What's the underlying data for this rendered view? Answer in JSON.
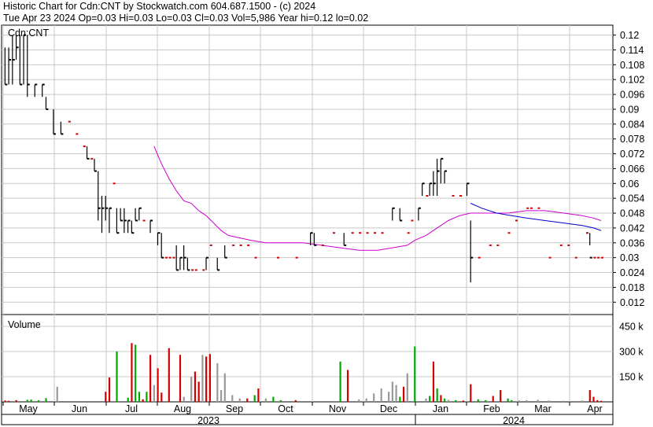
{
  "header": {
    "title": "Historic Chart for Cdn:CNT by Stockwatch.com 604.687.1500 - (c) 2024",
    "quote": "Tue Apr 23 2024  Op=0.03  Hi=0.03  Lo=0.03  Cl=0.03  Vol=5,986  Year hi=0.12  lo=0.02"
  },
  "chart_data": {
    "type": "bar",
    "symbol_label": "Cdn:CNT",
    "volume_label": "Volume",
    "price_axis": {
      "ticks": [
        0.12,
        0.114,
        0.108,
        0.102,
        0.096,
        0.09,
        0.084,
        0.078,
        0.072,
        0.066,
        0.06,
        0.054,
        0.048,
        0.042,
        0.036,
        0.03,
        0.024,
        0.018,
        0.012
      ],
      "range": [
        0.007,
        0.124
      ]
    },
    "volume_axis": {
      "ticks": [
        "450 k",
        "300 k",
        "150 k"
      ],
      "tick_values": [
        450000,
        300000,
        150000
      ],
      "range": [
        0,
        520000
      ]
    },
    "months": [
      "May",
      "Jun",
      "Jul",
      "Aug",
      "Sep",
      "Oct",
      "Nov",
      "Dec",
      "Jan",
      "Feb",
      "Mar",
      "Apr"
    ],
    "years": [
      "2023",
      "2024"
    ],
    "colors": {
      "up": "#d40000",
      "down": "#000000",
      "ma_short": "#0000cc",
      "ma_long": "#cc00cc",
      "vol_up": "#00aa00",
      "vol_down": "#d40000",
      "vol_flat": "#999999",
      "grid": "#c8c8c8"
    },
    "price_bars": [
      [
        0,
        0.115,
        0.1,
        0.1
      ],
      [
        1,
        0.115,
        0.1,
        0.11
      ],
      [
        2,
        0.12,
        0.1,
        0.11
      ],
      [
        3,
        0.12,
        0.11,
        0.115
      ],
      [
        4,
        0.12,
        0.1,
        0.1
      ],
      [
        5,
        0.12,
        0.1,
        0.12
      ],
      [
        6,
        0.12,
        0.095,
        0.1
      ],
      [
        8,
        0.1,
        0.095,
        0.1
      ],
      [
        10,
        0.1,
        0.095,
        0.1
      ],
      [
        11,
        0.095,
        0.09,
        0.09
      ],
      [
        13,
        0.09,
        0.08,
        0.08
      ],
      [
        15,
        0.085,
        0.08,
        0.08
      ],
      [
        17,
        0.085,
        0.085,
        0.085
      ],
      [
        19,
        0.08,
        0.08,
        0.08
      ],
      [
        21,
        0.075,
        0.075,
        0.075
      ],
      [
        22,
        0.075,
        0.07,
        0.07
      ],
      [
        23,
        0.07,
        0.07,
        0.07
      ],
      [
        24,
        0.07,
        0.065,
        0.065
      ],
      [
        25,
        0.065,
        0.045,
        0.05
      ],
      [
        26,
        0.055,
        0.04,
        0.05
      ],
      [
        27,
        0.055,
        0.045,
        0.05
      ],
      [
        28,
        0.05,
        0.04,
        0.05
      ],
      [
        29,
        0.06,
        0.06,
        0.06
      ],
      [
        30,
        0.05,
        0.04,
        0.04
      ],
      [
        31,
        0.05,
        0.045,
        0.045
      ],
      [
        32,
        0.05,
        0.04,
        0.045
      ],
      [
        33,
        0.045,
        0.04,
        0.045
      ],
      [
        34,
        0.045,
        0.04,
        0.04
      ],
      [
        35,
        0.05,
        0.045,
        0.045
      ],
      [
        36,
        0.05,
        0.045,
        0.05
      ],
      [
        37,
        0.045,
        0.045,
        0.045
      ],
      [
        39,
        0.045,
        0.04,
        0.045
      ],
      [
        41,
        0.04,
        0.035,
        0.04
      ],
      [
        42,
        0.04,
        0.03,
        0.03
      ],
      [
        43,
        0.03,
        0.03,
        0.03
      ],
      [
        44,
        0.03,
        0.03,
        0.03
      ],
      [
        45,
        0.03,
        0.03,
        0.03
      ],
      [
        46,
        0.035,
        0.025,
        0.025
      ],
      [
        47,
        0.03,
        0.025,
        0.03
      ],
      [
        48,
        0.035,
        0.025,
        0.03
      ],
      [
        49,
        0.03,
        0.025,
        0.025
      ],
      [
        50,
        0.025,
        0.025,
        0.025
      ],
      [
        51,
        0.025,
        0.025,
        0.025
      ],
      [
        53,
        0.025,
        0.025,
        0.025
      ],
      [
        54,
        0.03,
        0.025,
        0.03
      ],
      [
        55,
        0.035,
        0.035,
        0.035
      ],
      [
        57,
        0.03,
        0.025,
        0.025
      ],
      [
        59,
        0.035,
        0.03,
        0.03
      ],
      [
        61,
        0.035,
        0.035,
        0.035
      ],
      [
        63,
        0.035,
        0.035,
        0.035
      ],
      [
        65,
        0.035,
        0.035,
        0.035
      ],
      [
        67,
        0.03,
        0.03,
        0.03
      ],
      [
        73,
        0.03,
        0.03,
        0.03
      ],
      [
        78,
        0.03,
        0.03,
        0.03
      ],
      [
        82,
        0.04,
        0.035,
        0.04
      ],
      [
        83,
        0.04,
        0.035,
        0.035
      ],
      [
        85,
        0.035,
        0.035,
        0.035
      ],
      [
        88,
        0.04,
        0.04,
        0.04
      ],
      [
        91,
        0.04,
        0.035,
        0.035
      ],
      [
        93,
        0.04,
        0.04,
        0.04
      ],
      [
        95,
        0.04,
        0.04,
        0.04
      ],
      [
        97,
        0.04,
        0.04,
        0.04
      ],
      [
        99,
        0.04,
        0.04,
        0.04
      ],
      [
        101,
        0.04,
        0.04,
        0.04
      ],
      [
        104,
        0.05,
        0.045,
        0.05
      ],
      [
        106,
        0.05,
        0.045,
        0.045
      ],
      [
        108,
        0.04,
        0.04,
        0.04
      ],
      [
        109,
        0.045,
        0.045,
        0.045
      ],
      [
        111,
        0.05,
        0.045,
        0.05
      ],
      [
        112,
        0.06,
        0.055,
        0.06
      ],
      [
        113,
        0.055,
        0.055,
        0.055
      ],
      [
        114,
        0.06,
        0.055,
        0.06
      ],
      [
        115,
        0.065,
        0.055,
        0.06
      ],
      [
        116,
        0.07,
        0.055,
        0.065
      ],
      [
        117,
        0.07,
        0.06,
        0.07
      ],
      [
        118,
        0.065,
        0.06,
        0.065
      ],
      [
        120,
        0.055,
        0.055,
        0.055
      ],
      [
        122,
        0.055,
        0.055,
        0.055
      ],
      [
        124,
        0.06,
        0.055,
        0.06
      ],
      [
        125,
        0.045,
        0.02,
        0.03
      ],
      [
        127,
        0.03,
        0.03,
        0.03
      ],
      [
        130,
        0.035,
        0.035,
        0.035
      ],
      [
        132,
        0.035,
        0.035,
        0.035
      ],
      [
        135,
        0.04,
        0.04,
        0.04
      ],
      [
        137,
        0.045,
        0.045,
        0.045
      ],
      [
        140,
        0.05,
        0.05,
        0.05
      ],
      [
        141,
        0.05,
        0.05,
        0.05
      ],
      [
        143,
        0.05,
        0.05,
        0.05
      ],
      [
        146,
        0.03,
        0.03,
        0.03
      ],
      [
        149,
        0.035,
        0.035,
        0.035
      ],
      [
        151,
        0.035,
        0.035,
        0.035
      ],
      [
        153,
        0.03,
        0.03,
        0.03
      ],
      [
        156,
        0.04,
        0.04,
        0.04
      ],
      [
        157,
        0.04,
        0.035,
        0.03
      ],
      [
        158,
        0.03,
        0.03,
        0.03
      ],
      [
        159,
        0.03,
        0.03,
        0.03
      ],
      [
        160,
        0.03,
        0.03,
        0.03
      ]
    ],
    "ma_long": [
      [
        40,
        0.075
      ],
      [
        42,
        0.068
      ],
      [
        44,
        0.062
      ],
      [
        46,
        0.057
      ],
      [
        48,
        0.053
      ],
      [
        50,
        0.052
      ],
      [
        52,
        0.049
      ],
      [
        54,
        0.047
      ],
      [
        56,
        0.044
      ],
      [
        58,
        0.041
      ],
      [
        60,
        0.039
      ],
      [
        63,
        0.038
      ],
      [
        66,
        0.037
      ],
      [
        70,
        0.036
      ],
      [
        75,
        0.036
      ],
      [
        80,
        0.036
      ],
      [
        85,
        0.035
      ],
      [
        90,
        0.034
      ],
      [
        95,
        0.033
      ],
      [
        100,
        0.033
      ],
      [
        104,
        0.034
      ],
      [
        108,
        0.035
      ],
      [
        110,
        0.037
      ],
      [
        113,
        0.039
      ],
      [
        116,
        0.042
      ],
      [
        119,
        0.045
      ],
      [
        122,
        0.047
      ],
      [
        125,
        0.048
      ],
      [
        130,
        0.048
      ],
      [
        135,
        0.048
      ],
      [
        140,
        0.049
      ],
      [
        145,
        0.049
      ],
      [
        150,
        0.048
      ],
      [
        155,
        0.047
      ],
      [
        158,
        0.046
      ],
      [
        160,
        0.045
      ]
    ],
    "ma_short": [
      [
        125,
        0.052
      ],
      [
        128,
        0.05
      ],
      [
        132,
        0.048
      ],
      [
        136,
        0.047
      ],
      [
        140,
        0.046
      ],
      [
        145,
        0.045
      ],
      [
        150,
        0.044
      ],
      [
        155,
        0.043
      ],
      [
        158,
        0.042
      ],
      [
        160,
        0.041
      ]
    ],
    "volume_bars": [
      [
        0,
        8000,
        "down"
      ],
      [
        1,
        6000,
        "down"
      ],
      [
        3,
        10000,
        "down"
      ],
      [
        6,
        12000,
        "up"
      ],
      [
        7,
        14000,
        "up"
      ],
      [
        9,
        9000,
        "up"
      ],
      [
        11,
        22000,
        "up"
      ],
      [
        14,
        90000,
        "flat"
      ],
      [
        27,
        60000,
        "down"
      ],
      [
        28,
        145000,
        "down"
      ],
      [
        30,
        300000,
        "up"
      ],
      [
        33,
        25000,
        "up"
      ],
      [
        34,
        350000,
        "down"
      ],
      [
        35,
        340000,
        "up"
      ],
      [
        36,
        60000,
        "up"
      ],
      [
        37,
        15000,
        "down"
      ],
      [
        38,
        60000,
        "up"
      ],
      [
        39,
        280000,
        "down"
      ],
      [
        40,
        100000,
        "flat"
      ],
      [
        41,
        200000,
        "down"
      ],
      [
        42,
        55000,
        "down"
      ],
      [
        44,
        320000,
        "down"
      ],
      [
        47,
        280000,
        "down"
      ],
      [
        48,
        30000,
        "flat"
      ],
      [
        50,
        150000,
        "flat"
      ],
      [
        51,
        180000,
        "down"
      ],
      [
        52,
        120000,
        "down"
      ],
      [
        53,
        280000,
        "flat"
      ],
      [
        54,
        270000,
        "down"
      ],
      [
        55,
        285000,
        "down"
      ],
      [
        57,
        230000,
        "flat"
      ],
      [
        58,
        70000,
        "flat"
      ],
      [
        59,
        170000,
        "flat"
      ],
      [
        61,
        40000,
        "flat"
      ],
      [
        63,
        20000,
        "flat"
      ],
      [
        65,
        20000,
        "down"
      ],
      [
        67,
        40000,
        "up"
      ],
      [
        68,
        80000,
        "down"
      ],
      [
        70,
        20000,
        "flat"
      ],
      [
        72,
        30000,
        "up"
      ],
      [
        74,
        10000,
        "up"
      ],
      [
        78,
        10000,
        "down"
      ],
      [
        90,
        240000,
        "up"
      ],
      [
        92,
        190000,
        "down"
      ],
      [
        95,
        15000,
        "flat"
      ],
      [
        97,
        20000,
        "flat"
      ],
      [
        99,
        50000,
        "flat"
      ],
      [
        101,
        80000,
        "flat"
      ],
      [
        103,
        60000,
        "flat"
      ],
      [
        104,
        120000,
        "flat"
      ],
      [
        105,
        100000,
        "flat"
      ],
      [
        106,
        30000,
        "up"
      ],
      [
        107,
        90000,
        "down"
      ],
      [
        108,
        170000,
        "flat"
      ],
      [
        110,
        330000,
        "up"
      ],
      [
        113,
        20000,
        "flat"
      ],
      [
        114,
        35000,
        "up"
      ],
      [
        115,
        240000,
        "down"
      ],
      [
        116,
        80000,
        "up"
      ],
      [
        117,
        40000,
        "down"
      ],
      [
        118,
        20000,
        "up"
      ],
      [
        119,
        12000,
        "flat"
      ],
      [
        121,
        10000,
        "up"
      ],
      [
        123,
        8000,
        "down"
      ],
      [
        125,
        105000,
        "down"
      ],
      [
        127,
        15000,
        "up"
      ],
      [
        129,
        10000,
        "up"
      ],
      [
        131,
        35000,
        "down"
      ],
      [
        133,
        70000,
        "down"
      ],
      [
        135,
        20000,
        "up"
      ],
      [
        136,
        10000,
        "up"
      ],
      [
        138,
        8000,
        "flat"
      ],
      [
        140,
        10000,
        "flat"
      ],
      [
        143,
        12000,
        "flat"
      ],
      [
        146,
        8000,
        "flat"
      ],
      [
        150,
        6000,
        "flat"
      ],
      [
        153,
        5000,
        "flat"
      ],
      [
        155,
        8000,
        "flat"
      ],
      [
        157,
        70000,
        "down"
      ],
      [
        158,
        30000,
        "down"
      ],
      [
        159,
        10000,
        "down"
      ],
      [
        160,
        6000,
        "down"
      ]
    ],
    "month_starts": [
      0,
      20,
      40,
      61,
      82,
      103,
      124,
      145,
      166,
      187,
      208,
      229
    ],
    "n_sessions": 162
  }
}
